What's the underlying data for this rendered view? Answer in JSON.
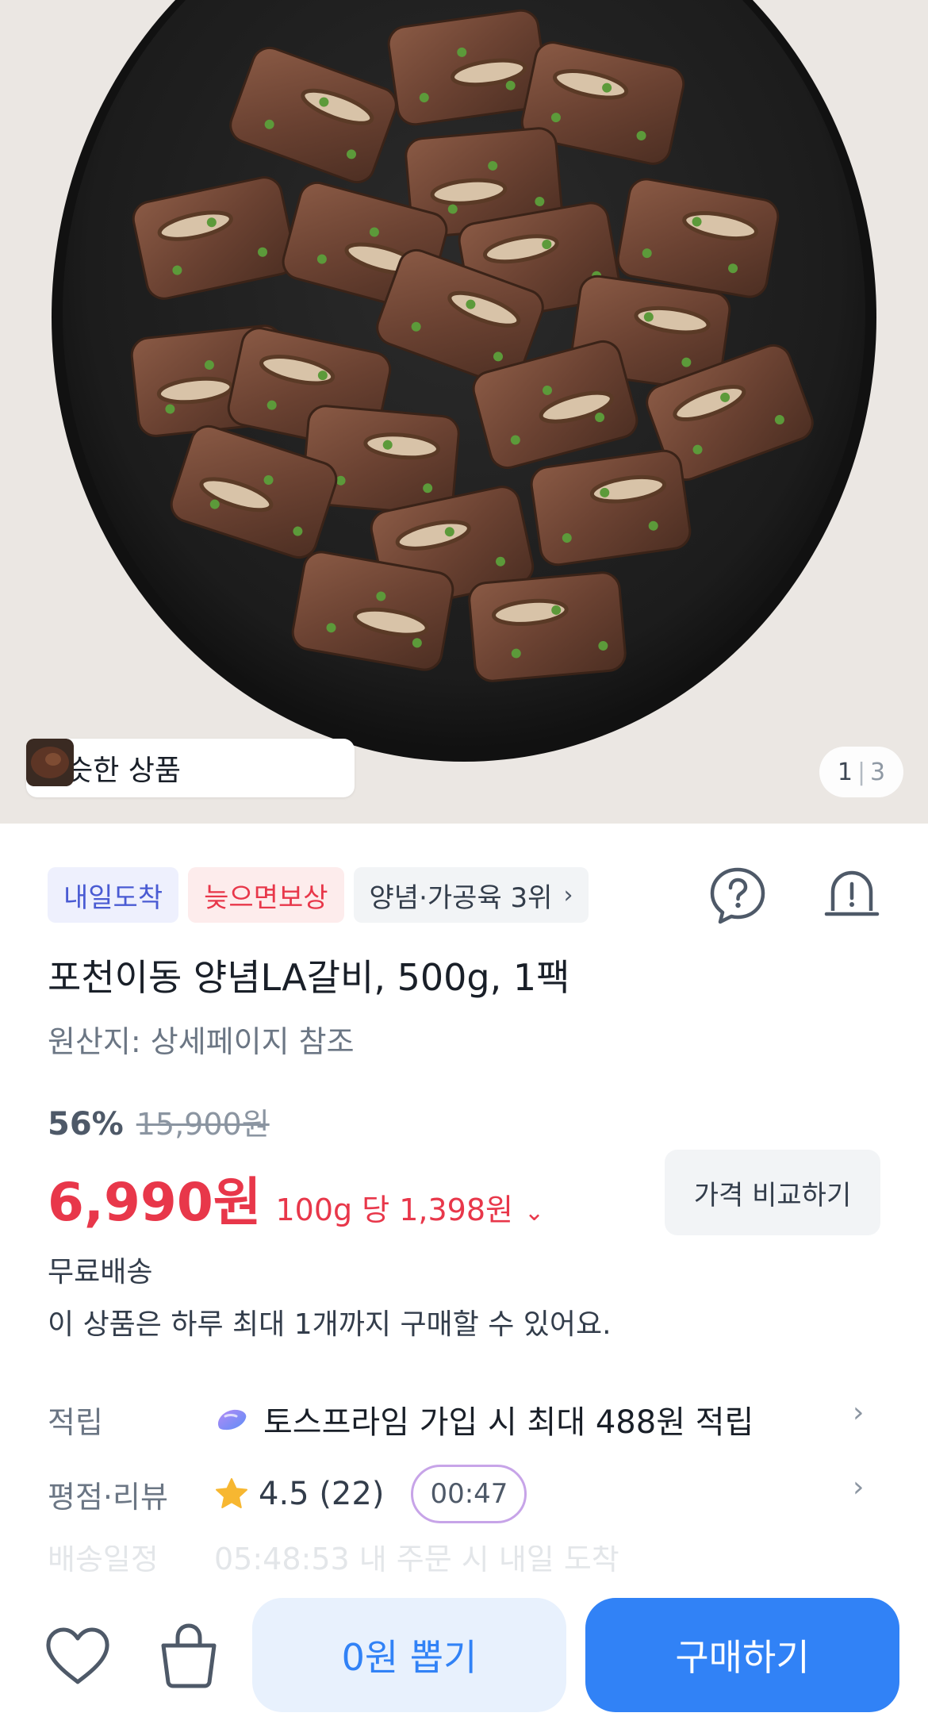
{
  "hero": {
    "image_name": "grilled-la-galbi-plate",
    "similar_label": "비슷한 상품",
    "pager_current": "1",
    "pager_total": "3"
  },
  "chips": {
    "arrival": "내일도착",
    "late_comp": "늦으면보상",
    "ranking": "양념·가공육 3위"
  },
  "product": {
    "title": "포천이동 양념LA갈비, 500g, 1팩",
    "origin": "원산지: 상세페이지 참조"
  },
  "pricing": {
    "discount": "56%",
    "original_price": "15,900원",
    "price": "6,990원",
    "unit_price": "100g 당 1,398원",
    "compare_label": "가격 비교하기"
  },
  "shipping": "무료배송",
  "purchase_limit": "이 상품은 하루 최대 1개까지 구매할 수 있어요.",
  "points": {
    "label": "적립",
    "text": "토스프라임 가입 시 최대 488원 적립"
  },
  "review": {
    "label": "평점·리뷰",
    "rating_text": "4.5 (22)",
    "timer": "00:47"
  },
  "delivery": {
    "label": "배송일정",
    "text": "05:48:53 내 주문 시 내일 도착"
  },
  "bottom_bar": {
    "draw_label": "0원 뽑기",
    "buy_label": "구매하기"
  },
  "colors": {
    "accent_blue": "#3182f6",
    "price_red": "#e8374a",
    "chip_blue": "#4a5bd3"
  },
  "icons": [
    "question-icon",
    "report-icon",
    "chevron-right-icon",
    "star-icon",
    "heart-icon",
    "shopping-bag-icon"
  ]
}
